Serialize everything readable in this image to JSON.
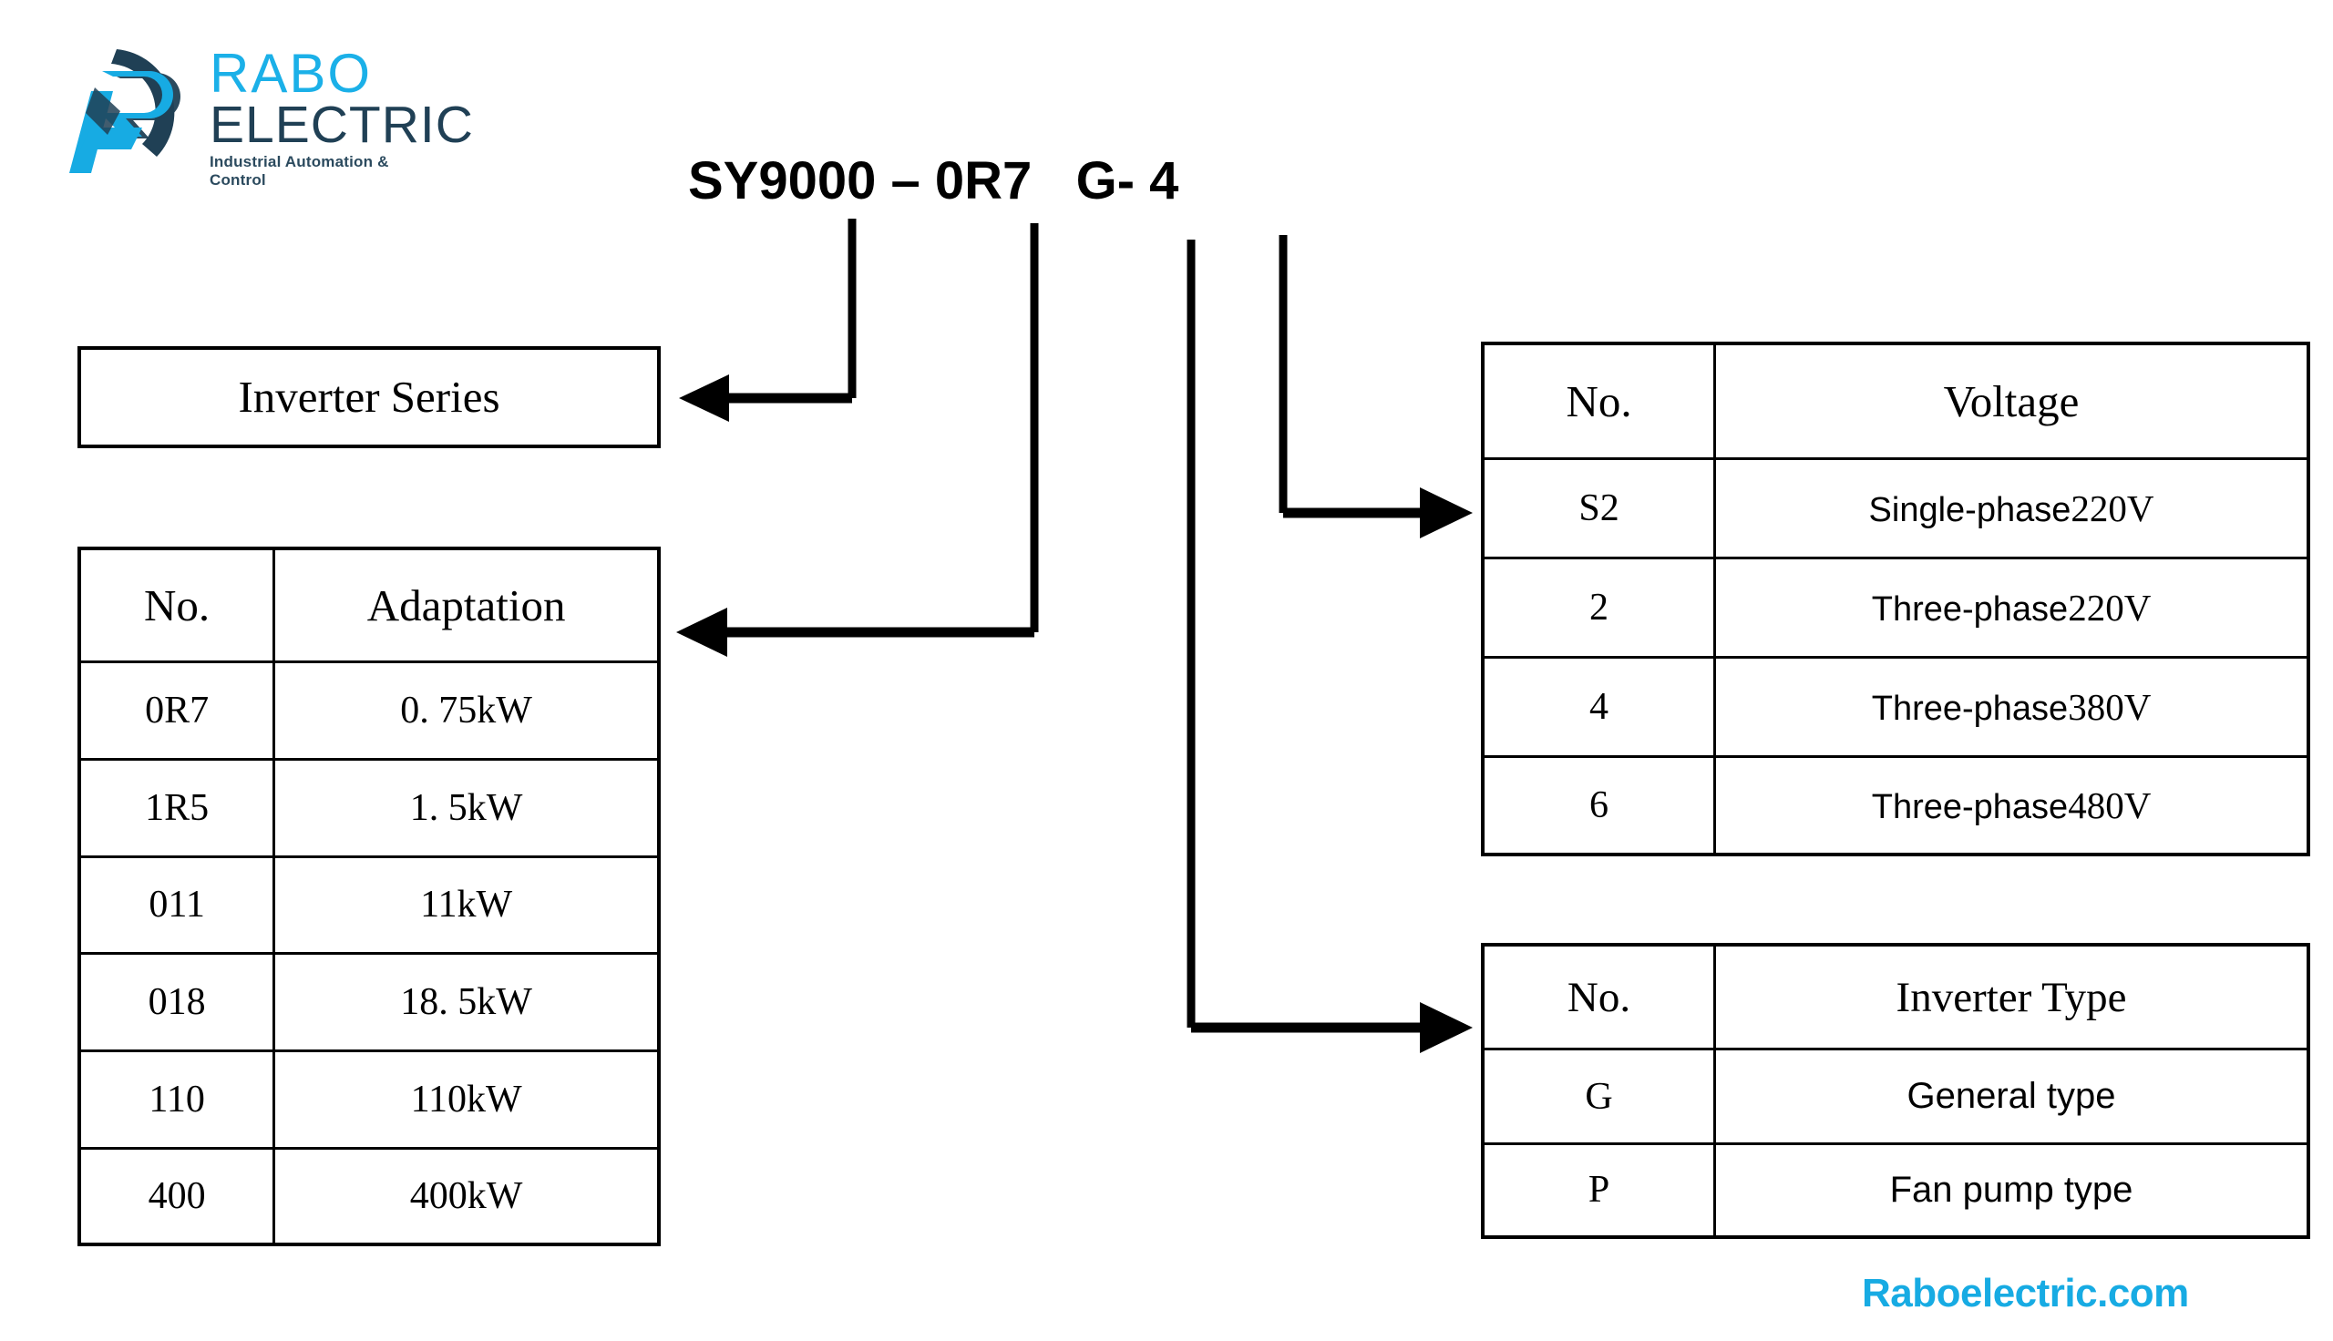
{
  "brand": {
    "name_primary": "RABO",
    "name_secondary": "ELECTRIC",
    "tagline": "Industrial Automation & Control",
    "primary_color": "#1BB0E8",
    "secondary_color": "#204055",
    "footer_url": "Raboelectric.com",
    "footer_url_color": "#17ABE3"
  },
  "model_code": "SY9000 – 0R7   G- 4",
  "inverter_series": {
    "label": "Inverter Series"
  },
  "adaptation_table": {
    "headers": [
      "No.",
      "Adaptation"
    ],
    "rows": [
      [
        "0R7",
        "0. 75kW"
      ],
      [
        "1R5",
        "1. 5kW"
      ],
      [
        "011",
        "11kW"
      ],
      [
        "018",
        "18. 5kW"
      ],
      [
        "110",
        "110kW"
      ],
      [
        "400",
        "400kW"
      ]
    ]
  },
  "voltage_table": {
    "headers": [
      "No.",
      "Voltage"
    ],
    "rows": [
      {
        "no": "S2",
        "phase": "Single-phase",
        "volt": "220V"
      },
      {
        "no": "2",
        "phase": "Three-phase",
        "volt": "220V"
      },
      {
        "no": "4",
        "phase": "Three-phase",
        "volt": "380V"
      },
      {
        "no": "6",
        "phase": "Three-phase",
        "volt": "480V"
      }
    ]
  },
  "inverter_type_table": {
    "headers": [
      "No.",
      "Inverter Type"
    ],
    "rows": [
      [
        "G",
        "General type"
      ],
      [
        "P",
        "Fan pump type"
      ]
    ]
  }
}
